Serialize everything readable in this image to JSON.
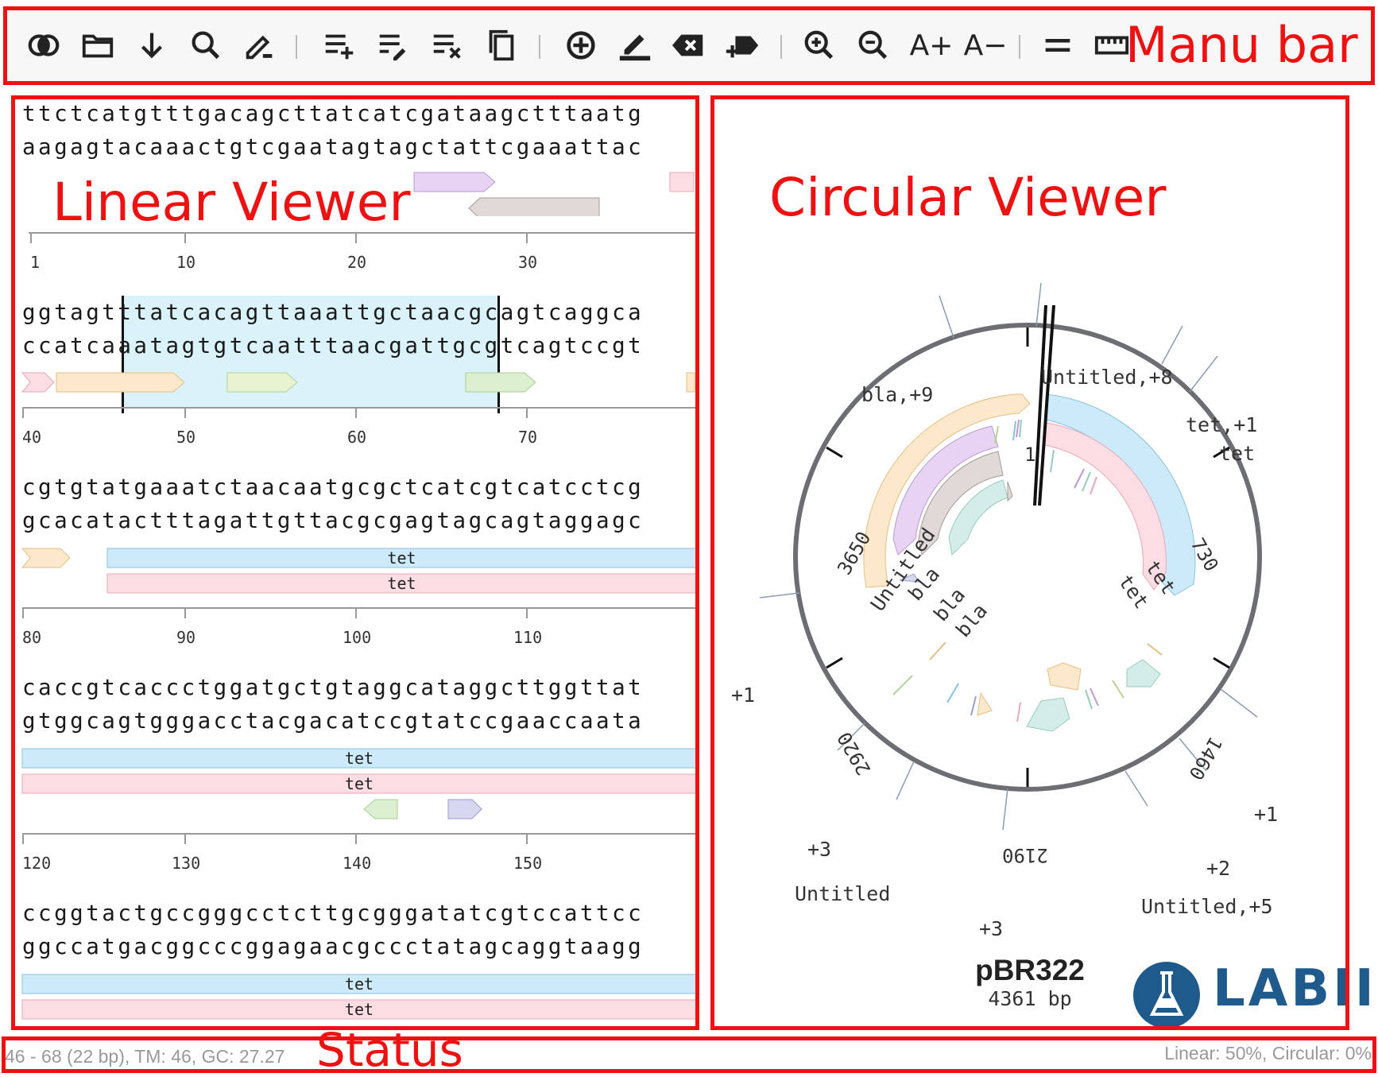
{
  "labels": {
    "menu_bar": "Manu bar",
    "linear_viewer": "Linear Viewer",
    "circular_viewer": "Circular Viewer",
    "status": "Status"
  },
  "toolbar": {
    "icons": [
      "circular-linear-toggle-icon",
      "open-folder-icon",
      "download-icon",
      "search-icon",
      "edit-icon",
      "insert-lines-icon",
      "edit-lines-icon",
      "clear-lines-icon",
      "copy-icon",
      "add-feature-icon",
      "highlight-icon",
      "delete-icon",
      "add-tag-icon",
      "zoom-in-icon",
      "zoom-out-icon",
      "font-increase-icon",
      "font-decrease-icon",
      "equals-icon",
      "ruler-icon"
    ],
    "font_increase": "A+",
    "font_decrease": "A−"
  },
  "linear": {
    "rows": [
      {
        "top": "ttctcatgtttgacagcttatcatcgataagctttaatg",
        "bottom": "aagagtacaaactgtcgaatagtagctattcgaaattac",
        "ticks": [
          "1",
          "10",
          "20",
          "30"
        ]
      },
      {
        "top": "ggtagtttatcacagttaaattgctaacgcagtcaggca",
        "bottom": "ccatcaaatagtgtcaatttaacgattgcgtcagtccgt",
        "ticks": [
          "40",
          "50",
          "60",
          "70"
        ]
      },
      {
        "top": "cgtgtatgaaatctaacaatgcgctcatcgtcatcctcg",
        "bottom": "gcacatactttagattgttacgcgagtagcagtaggagc",
        "ticks": [
          "80",
          "90",
          "100",
          "110"
        ],
        "features": [
          "tet",
          "tet"
        ]
      },
      {
        "top": "caccgtcaccctggatgctgtaggcataggcttggttat",
        "bottom": "gtggcagtgggacctacgacatccgtatccgaaccaata",
        "ticks": [
          "120",
          "130",
          "140",
          "150"
        ],
        "features": [
          "tet",
          "tet"
        ]
      },
      {
        "top": "ccggtactgccgggcctcttgcgggatatcgtccattcc",
        "bottom": "ggccatgacggcccggagaacgccctatagcaggtaagg",
        "features": [
          "tet",
          "tet"
        ]
      }
    ]
  },
  "circular": {
    "name": "pBR322",
    "length": "4361 bp",
    "ticks": [
      "1",
      "730",
      "1460",
      "2190",
      "2920",
      "3650"
    ],
    "outer_labels": [
      "Untitled,+8",
      "bla,+9",
      "tet,+1",
      "tet",
      "+1",
      "+1",
      "+2",
      "Untitled,+5",
      "+3",
      "+3",
      "Untitled"
    ],
    "arc_labels": [
      "Untitled",
      "bla",
      "bla",
      "bla",
      "tet",
      "tet"
    ],
    "logo_text": "LABII"
  },
  "status": {
    "selection": "46 - 68 (22 bp), TM: 46, GC: 27.27",
    "zoom": "Linear: 50%, Circular: 0%"
  },
  "colors": {
    "annotation_red": "#ee1111",
    "tet_blue": "#cdeafa",
    "tet_pink": "#fddde4",
    "selection": "#daf3fb",
    "logo": "#1f5a8c"
  }
}
